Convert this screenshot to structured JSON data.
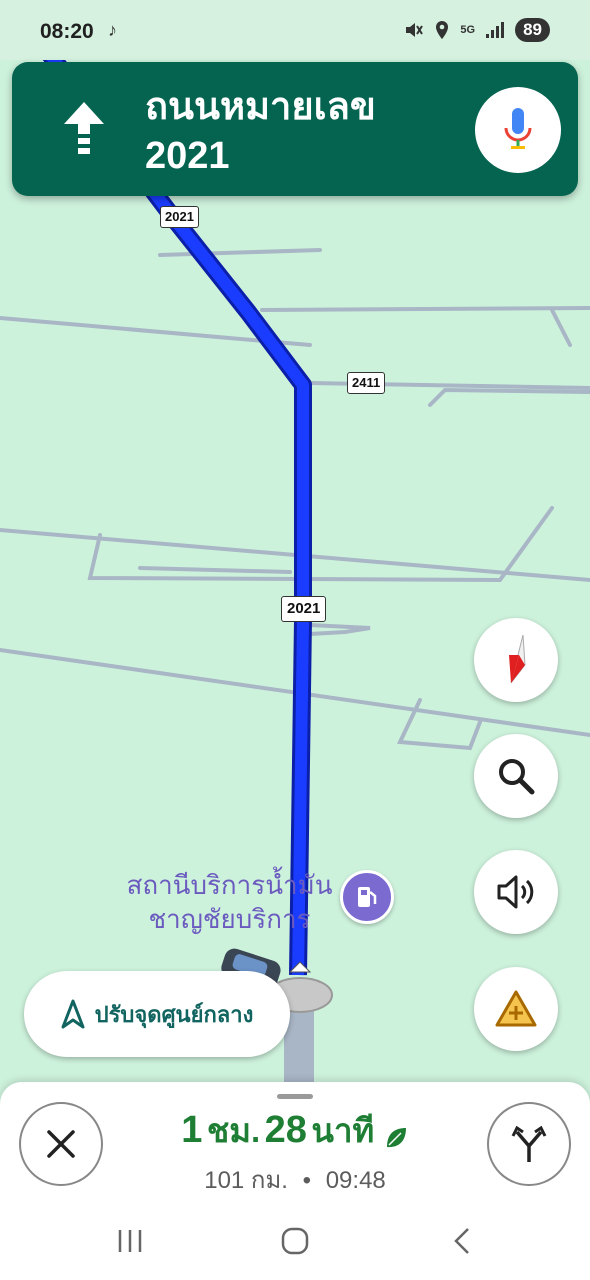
{
  "status_bar": {
    "time": "08:20",
    "app_icon": "tiktok-icon",
    "mute_icon": "mute-icon",
    "location_icon": "location-icon",
    "network": "5G",
    "signal_icon": "signal-icon",
    "battery": "89"
  },
  "navigation": {
    "direction_icon": "straight-arrow-icon",
    "street_name": "ถนนหมายเลข",
    "street_number": "2021",
    "mic_icon": "microphone-icon"
  },
  "map": {
    "route_signs": [
      "2021",
      "2411",
      "2021"
    ],
    "poi": {
      "name_line1": "สถานีบริการน้ำมัน",
      "name_line2": "ชาญชัยบริการ",
      "icon": "gas-station-icon"
    },
    "route_color": "#1a3cff"
  },
  "controls": {
    "compass_icon": "compass-icon",
    "search_icon": "search-icon",
    "sound_icon": "volume-icon",
    "report_icon": "report-incident-icon",
    "recenter_label": "ปรับจุดศูนย์กลาง",
    "recenter_icon": "navigation-arrow-icon"
  },
  "trip": {
    "duration_hours": "1",
    "duration_hours_unit": "ชม.",
    "duration_minutes": "28",
    "duration_minutes_unit": "นาที",
    "eco_icon": "leaf-icon",
    "distance": "101 กม.",
    "separator": "•",
    "arrival_time": "09:48",
    "close_icon": "close-icon",
    "alternate_routes_icon": "fork-routes-icon"
  },
  "system_nav": {
    "recents_icon": "recents-icon",
    "home_icon": "home-icon",
    "back_icon": "back-icon"
  },
  "colors": {
    "banner": "#046450",
    "map_bg": "#cdf2dc",
    "route": "#1a3cff",
    "eta_green": "#1e7e34"
  }
}
